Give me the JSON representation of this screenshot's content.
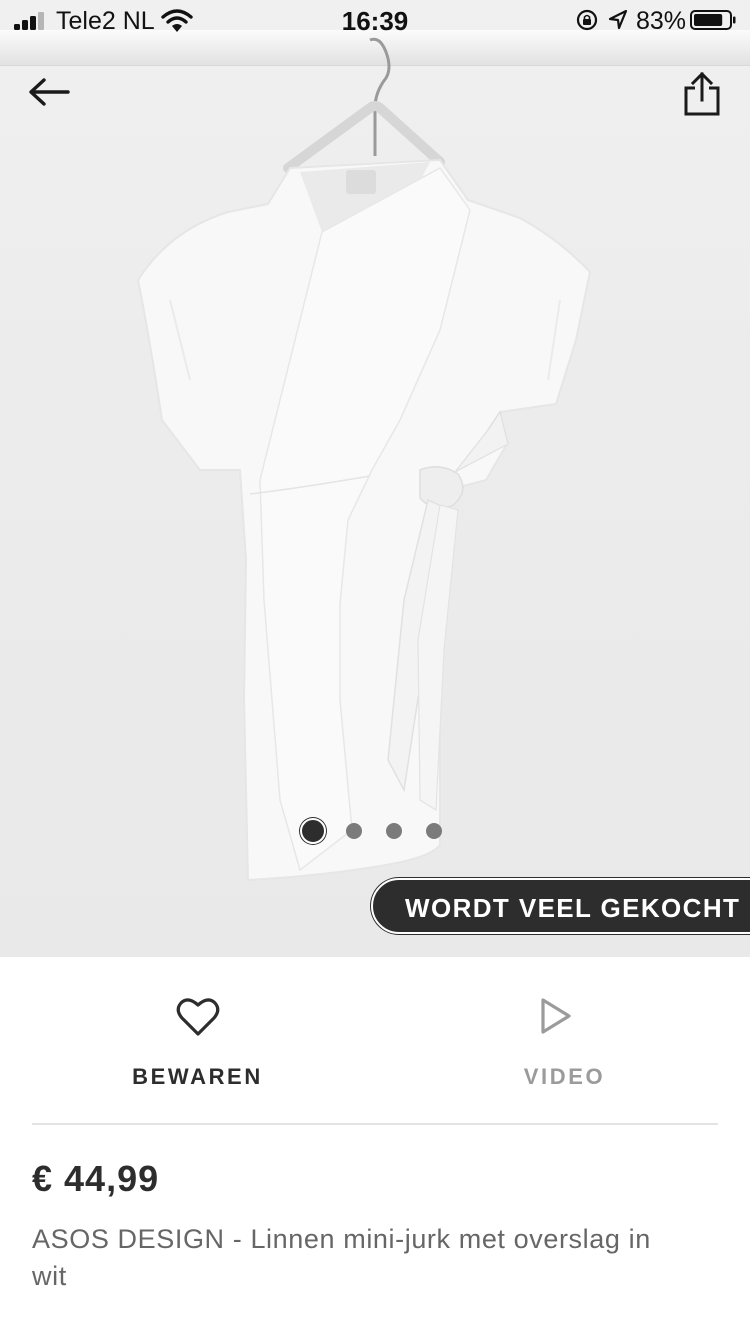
{
  "status_bar": {
    "carrier": "Tele2 NL",
    "time": "16:39",
    "battery_percent": "83%",
    "battery_level": 0.83,
    "signal_bars": 3,
    "icons": [
      "signal-icon",
      "wifi-icon",
      "orientation-lock-icon",
      "location-icon",
      "battery-icon"
    ]
  },
  "nav": {
    "icons": [
      "back-arrow-icon",
      "share-icon"
    ]
  },
  "product_image": {
    "carousel_count": 4,
    "active_index": 0,
    "badge": "WORDT VEEL GEKOCHT"
  },
  "actions": {
    "save_label": "BEWAREN",
    "save_icon": "heart-icon",
    "video_label": "VIDEO",
    "video_icon": "play-icon"
  },
  "product": {
    "price": "€ 44,99",
    "title": "ASOS DESIGN - Linnen mini-jurk met overslag in wit"
  },
  "colors": {
    "text_dark": "#2d2d2d",
    "text_muted": "#666666",
    "label_disabled": "#9b9b9b",
    "badge_bg": "#2d2d2d",
    "badge_text": "#ffffff",
    "image_bg": "#ececec"
  }
}
